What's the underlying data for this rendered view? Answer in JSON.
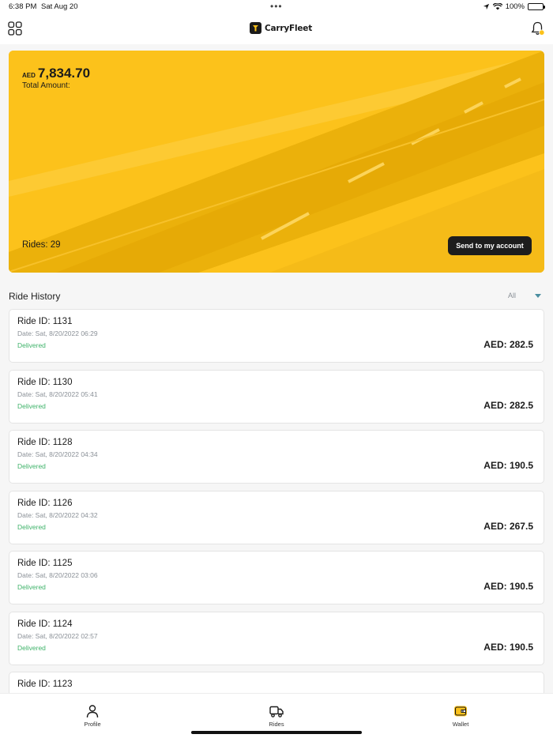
{
  "status_bar": {
    "time": "6:38 PM",
    "date": "Sat Aug 20",
    "battery": "100%",
    "icons": [
      "location-icon",
      "wifi-icon",
      "battery-icon"
    ]
  },
  "header": {
    "brand": "CarryFleet",
    "menu_icon": "grid-menu-icon",
    "notification_icon": "bell-icon",
    "notification_badge_color": "#fcc21b"
  },
  "summary": {
    "currency": "AED",
    "total_value": "7,834.70",
    "total_label": "Total Amount:",
    "rides_label": "Rides: 29",
    "send_button": "Send to my account",
    "accent_color": "#fcc21b"
  },
  "history": {
    "title": "Ride History",
    "filter_selected": "All",
    "rides": [
      {
        "id": "Ride ID: 1131",
        "date": "Date: Sat, 8/20/2022 06:29",
        "status": "Delivered",
        "amount": "AED: 282.5"
      },
      {
        "id": "Ride ID: 1130",
        "date": "Date: Sat, 8/20/2022 05:41",
        "status": "Delivered",
        "amount": "AED: 282.5"
      },
      {
        "id": "Ride ID: 1128",
        "date": "Date: Sat, 8/20/2022 04:34",
        "status": "Delivered",
        "amount": "AED: 190.5"
      },
      {
        "id": "Ride ID: 1126",
        "date": "Date: Sat, 8/20/2022 04:32",
        "status": "Delivered",
        "amount": "AED: 267.5"
      },
      {
        "id": "Ride ID: 1125",
        "date": "Date: Sat, 8/20/2022 03:06",
        "status": "Delivered",
        "amount": "AED: 190.5"
      },
      {
        "id": "Ride ID: 1124",
        "date": "Date: Sat, 8/20/2022 02:57",
        "status": "Delivered",
        "amount": "AED: 190.5"
      },
      {
        "id": "Ride ID: 1123",
        "date": "",
        "status": "",
        "amount": ""
      }
    ]
  },
  "tabs": [
    {
      "label": "Profile",
      "icon": "person-icon"
    },
    {
      "label": "Rides",
      "icon": "truck-icon"
    },
    {
      "label": "Wallet",
      "icon": "wallet-icon",
      "active": true
    }
  ]
}
